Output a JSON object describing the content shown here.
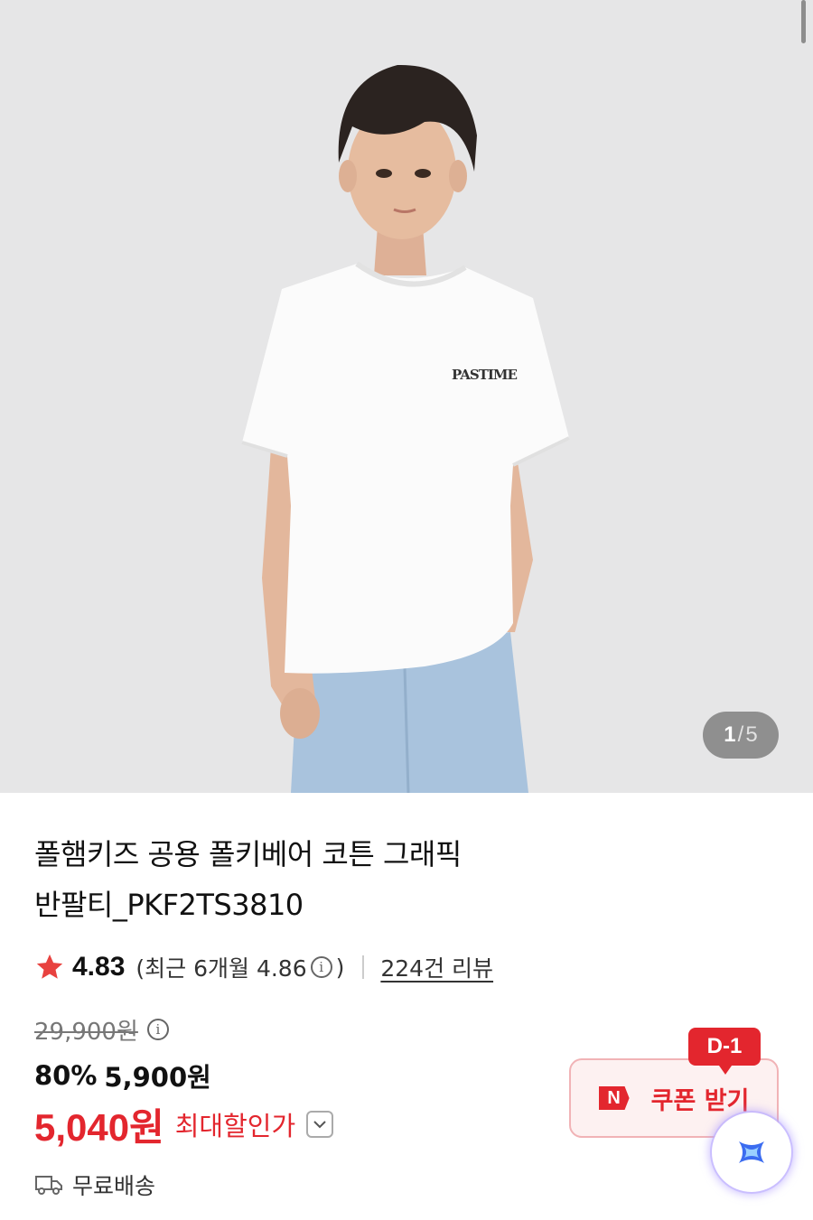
{
  "gallery": {
    "current": "1",
    "separator": "/",
    "total": "5",
    "shirt_graphic_text": "PASTIME"
  },
  "product": {
    "title_line1": "폴햄키즈 공용 폴키베어 코튼 그래픽",
    "title_line2": "반팔티_PKF2TS3810"
  },
  "rating": {
    "score": "4.83",
    "recent_prefix": "(최근 6개월 4.86",
    "recent_suffix": ")",
    "reviews": "224건 리뷰"
  },
  "price": {
    "original": "29,900원",
    "discount_percent": "80%",
    "sale_price": "5,900원",
    "final_price": "5,040원",
    "final_label": "최대할인가"
  },
  "shipping": {
    "label": "무료배송"
  },
  "coupon": {
    "badge": "N",
    "label": "쿠폰 받기",
    "dday": "D-1"
  },
  "colors": {
    "accent_red": "#e3262e",
    "hero_bg": "#e6e6e7"
  },
  "icons": [
    "star-icon",
    "info-icon",
    "chevron-down-icon",
    "truck-icon",
    "naver-n-icon",
    "assistant-icon"
  ]
}
